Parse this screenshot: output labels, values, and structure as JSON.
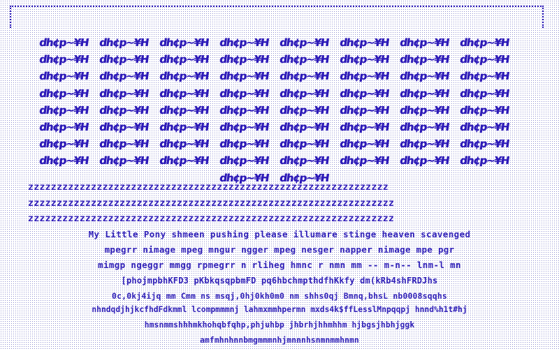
{
  "tile_text": "dh¢p~¥H",
  "tile_count": 66,
  "z_rows": [
    "zzzzzzzzzzzzzzzzzzzzzzzzzzzzzzzzzzzzzzzzzzzzzzzzzzzzzzzzzzzzzzz",
    "zzzzzzzzzzzzzzzzzzzzzzzzzzzzzzzzzzzzzzzzzzzzzzzzzzzzzzzzzzzzzzzz",
    "zzzzzzzzzzzzzzzzzzzzzzzzzzzzzzzzzzzzzzzzzzzzzzzzzzzzzzzzzzzzzzzz"
  ],
  "noise_lines": [
    "My Little Pony shmeen pushing please illumare stinge heaven scavenged",
    "mpegrr nimage mpeg mngur ngger mpeg nesger napper nimage mpe pgr",
    "mimgp ngeggr mmgg rpmegrr n rliheg hmnc r nmn mm -- m-n-- lnm-l mn",
    "[phojmpbhKFD3 pKbkqsqpbmFD pq6hbchmpthdfhKkfy dm(kRb4shFRDJhs",
    "0c,0kj4ijq mm Cmm ns msqj,0hj0kh0m0 nm shhs0qj Bmnq,bhsL nb0008sqqhs",
    "nhndqdjhjkcfhdFdkmml lcompmmmnj  lahmxmmhpermn mxds4k$ffLesslMnpqqpj hnnd%h1t#hj",
    "hmsnmmshhhmkhohqbfqhp,phjuhbp jhbrhjhhmhhm hjbgsjhbhjggk",
    "amfmhnhnnbmgmmmnhjmnnnhsnmnmmhnmn"
  ]
}
